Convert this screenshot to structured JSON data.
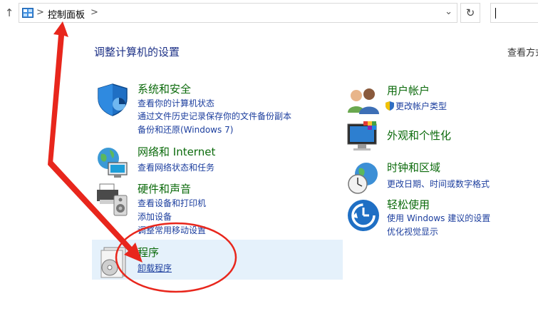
{
  "address_bar": {
    "breadcrumb": "控制面板",
    "separator": ">",
    "dropdown": "⌄",
    "refresh": "↻"
  },
  "page_title": "调整计算机的设置",
  "view_by": "查看方式",
  "categories": [
    {
      "title": "系统和安全",
      "links": [
        "查看你的计算机状态",
        "通过文件历史记录保存你的文件备份副本",
        "备份和还原(Windows 7)"
      ],
      "icon": "security-shield-icon"
    },
    {
      "title": "网络和 Internet",
      "links": [
        "查看网络状态和任务"
      ],
      "icon": "network-globe-icon"
    },
    {
      "title": "硬件和声音",
      "links": [
        "查看设备和打印机",
        "添加设备",
        "调整常用移动设置"
      ],
      "icon": "printer-speaker-icon"
    },
    {
      "title": "程序",
      "links": [
        "卸载程序"
      ],
      "icon": "programs-disc-icon",
      "highlighted": true
    },
    {
      "title": "用户帐户",
      "links": [
        "更改帐户类型"
      ],
      "icon": "users-icon"
    },
    {
      "title": "外观和个性化",
      "links": [],
      "icon": "monitor-palette-icon"
    },
    {
      "title": "时钟和区域",
      "links": [
        "更改日期、时间或数字格式"
      ],
      "icon": "clock-globe-icon"
    },
    {
      "title": "轻松使用",
      "links": [
        "使用 Windows 建议的设置",
        "优化视觉显示"
      ],
      "icon": "ease-of-access-icon"
    }
  ],
  "colors": {
    "category_title": "#0b6a0b",
    "link": "#1c3e9e",
    "highlight_bg": "#e5f1fb",
    "annotation": "#e8261c"
  }
}
